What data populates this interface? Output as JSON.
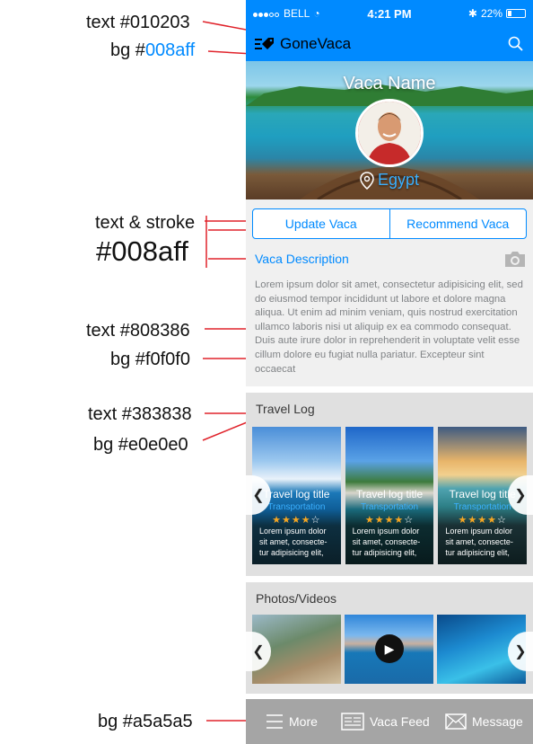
{
  "annotations": {
    "text_010203": "text #010203",
    "bg_008aff_prefix": "bg #",
    "bg_008aff_value": "008aff",
    "text_stroke": "text & stroke",
    "stroke_color": "#008aff",
    "text_808386": "text #808386",
    "bg_f0f0f0": "bg #f0f0f0",
    "text_383838": "text #383838",
    "bg_e0e0e0": "bg #e0e0e0",
    "bg_a5a5a5": "bg #a5a5a5"
  },
  "status_bar": {
    "carrier": "BELL",
    "time": "4:21 PM",
    "battery": "22%"
  },
  "nav": {
    "title": "GoneVaca",
    "logo_icon": "tags-icon",
    "search_icon": "search-icon"
  },
  "hero": {
    "vaca_name": "Vaca Name",
    "location": "Egypt"
  },
  "actions": {
    "update": "Update Vaca",
    "recommend": "Recommend Vaca"
  },
  "description": {
    "heading": "Vaca Description",
    "body": "Lorem ipsum dolor sit amet, consectetur adipisicing elit, sed do eiusmod tempor incididunt ut labore et dolore magna aliqua. Ut enim ad minim veniam, quis nostrud exercitation ullamco laboris nisi ut aliquip ex ea commodo consequat. Duis aute irure dolor in reprehenderit in voluptate velit esse cillum dolore eu fugiat nulla pariatur. Excepteur sint occaecat"
  },
  "travel_log": {
    "heading": "Travel Log",
    "cards": [
      {
        "title": "Travel log title",
        "subtitle": "Transportation",
        "rating": 4,
        "body": "Lorem ipsum dolor sit amet, consecte-tur adipisicing elit,"
      },
      {
        "title": "Travel log title",
        "subtitle": "Transportation",
        "rating": 4,
        "body": "Lorem ipsum dolor sit amet, consecte-tur adipisicing elit,"
      },
      {
        "title": "Travel log title",
        "subtitle": "Transportation",
        "rating": 4,
        "body": "Lorem ipsum dolor sit amet, consecte-tur adipisicing elit,"
      }
    ]
  },
  "photos": {
    "heading": "Photos/Videos"
  },
  "tabbar": {
    "more": "More",
    "feed": "Vaca Feed",
    "message": "Message"
  },
  "colors": {
    "brand": "#008aff",
    "text_dark": "#010203",
    "text_gray": "#808386",
    "bg_light": "#f0f0f0",
    "section_text": "#383838",
    "section_bg": "#e0e0e0",
    "tabbar_bg": "#a5a5a5"
  }
}
